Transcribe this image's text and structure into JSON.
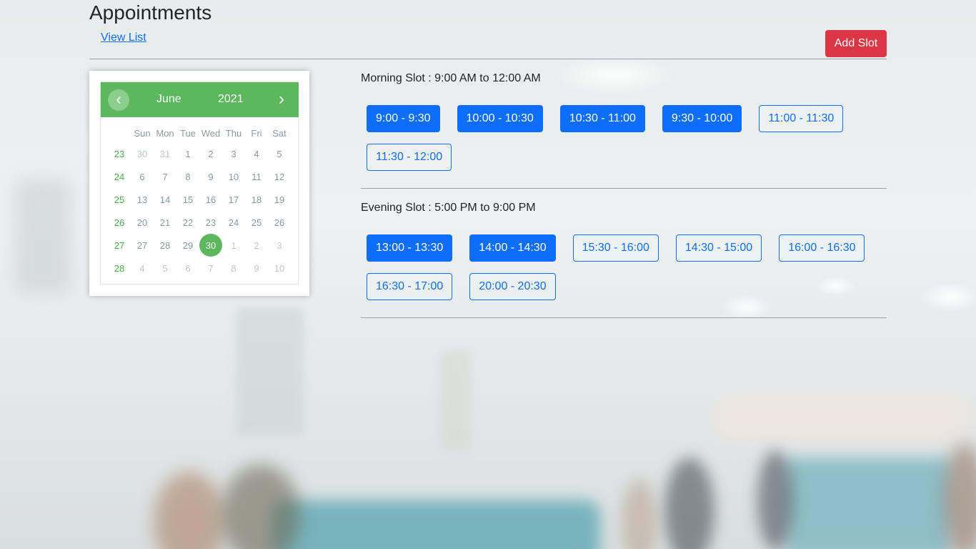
{
  "header": {
    "title": "Appointments",
    "view_list": "View List",
    "add_slot": "Add Slot"
  },
  "colors": {
    "primary": "#0d6efd",
    "danger": "#dc3545",
    "calendar_accent": "#5cb85c"
  },
  "calendar": {
    "month": "June",
    "year": "2021",
    "prev": "‹",
    "next": "›",
    "weekdays": [
      "Sun",
      "Mon",
      "Tue",
      "Wed",
      "Thu",
      "Fri",
      "Sat"
    ],
    "weeks": [
      {
        "week": "23",
        "days": [
          "30",
          "31",
          "1",
          "2",
          "3",
          "4",
          "5"
        ]
      },
      {
        "week": "24",
        "days": [
          "6",
          "7",
          "8",
          "9",
          "10",
          "11",
          "12"
        ]
      },
      {
        "week": "25",
        "days": [
          "13",
          "14",
          "15",
          "16",
          "17",
          "18",
          "19"
        ]
      },
      {
        "week": "26",
        "days": [
          "20",
          "21",
          "22",
          "23",
          "24",
          "25",
          "26"
        ]
      },
      {
        "week": "27",
        "days": [
          "27",
          "28",
          "29",
          "30",
          "1",
          "2",
          "3"
        ]
      },
      {
        "week": "28",
        "days": [
          "4",
          "5",
          "6",
          "7",
          "8",
          "9",
          "10"
        ]
      }
    ],
    "selected": "30"
  },
  "morning": {
    "title": "Morning Slot : 9:00 AM to 12:00 AM",
    "slots": [
      {
        "label": "9:00 - 9:30",
        "booked": true
      },
      {
        "label": "10:00 - 10:30",
        "booked": true
      },
      {
        "label": "10:30 - 11:00",
        "booked": true
      },
      {
        "label": "9:30 - 10:00",
        "booked": true
      },
      {
        "label": "11:00 - 11:30",
        "booked": false
      },
      {
        "label": "11:30 - 12:00",
        "booked": false
      }
    ]
  },
  "evening": {
    "title": "Evening Slot : 5:00 PM to 9:00 PM",
    "slots": [
      {
        "label": "13:00 - 13:30",
        "booked": true
      },
      {
        "label": "14:00 - 14:30",
        "booked": true
      },
      {
        "label": "15:30 - 16:00",
        "booked": false
      },
      {
        "label": "14:30 - 15:00",
        "booked": false
      },
      {
        "label": "16:00 - 16:30",
        "booked": false
      },
      {
        "label": "16:30 - 17:00",
        "booked": false
      },
      {
        "label": "20:00 - 20:30",
        "booked": false
      }
    ]
  }
}
